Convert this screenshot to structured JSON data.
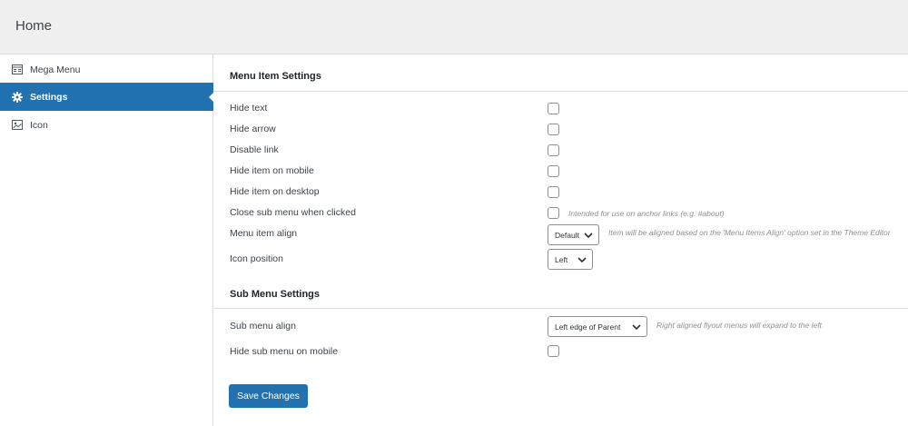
{
  "header": {
    "title": "Home"
  },
  "sidebar": {
    "items": [
      {
        "label": "Mega Menu",
        "icon": "mega-menu-icon"
      },
      {
        "label": "Settings",
        "icon": "gear-icon",
        "active": true
      },
      {
        "label": "Icon",
        "icon": "image-icon"
      }
    ]
  },
  "menu_item_settings": {
    "title": "Menu Item Settings",
    "rows": [
      {
        "label": "Hide text",
        "checked": false
      },
      {
        "label": "Hide arrow",
        "checked": false
      },
      {
        "label": "Disable link",
        "checked": false
      },
      {
        "label": "Hide item on mobile",
        "checked": false
      },
      {
        "label": "Hide item on desktop",
        "checked": false
      },
      {
        "label": "Close sub menu when clicked",
        "checked": false,
        "hint": "Intended for use on anchor links (e.g. #about)"
      }
    ],
    "menu_item_align": {
      "label": "Menu item align",
      "value": "Default",
      "hint": "Item will be aligned based on the 'Menu Items Align' option set in the Theme Editor"
    },
    "icon_position": {
      "label": "Icon position",
      "value": "Left"
    }
  },
  "sub_menu_settings": {
    "title": "Sub Menu Settings",
    "sub_menu_align": {
      "label": "Sub menu align",
      "value": "Left edge of Parent",
      "hint": "Right aligned flyout menus will expand to the left"
    },
    "hide_on_mobile": {
      "label": "Hide sub menu on mobile",
      "checked": false
    }
  },
  "actions": {
    "save_label": "Save Changes"
  },
  "colors": {
    "accent": "#2271b1",
    "header_bg": "#f0f0f1",
    "border": "#dcdcde"
  }
}
